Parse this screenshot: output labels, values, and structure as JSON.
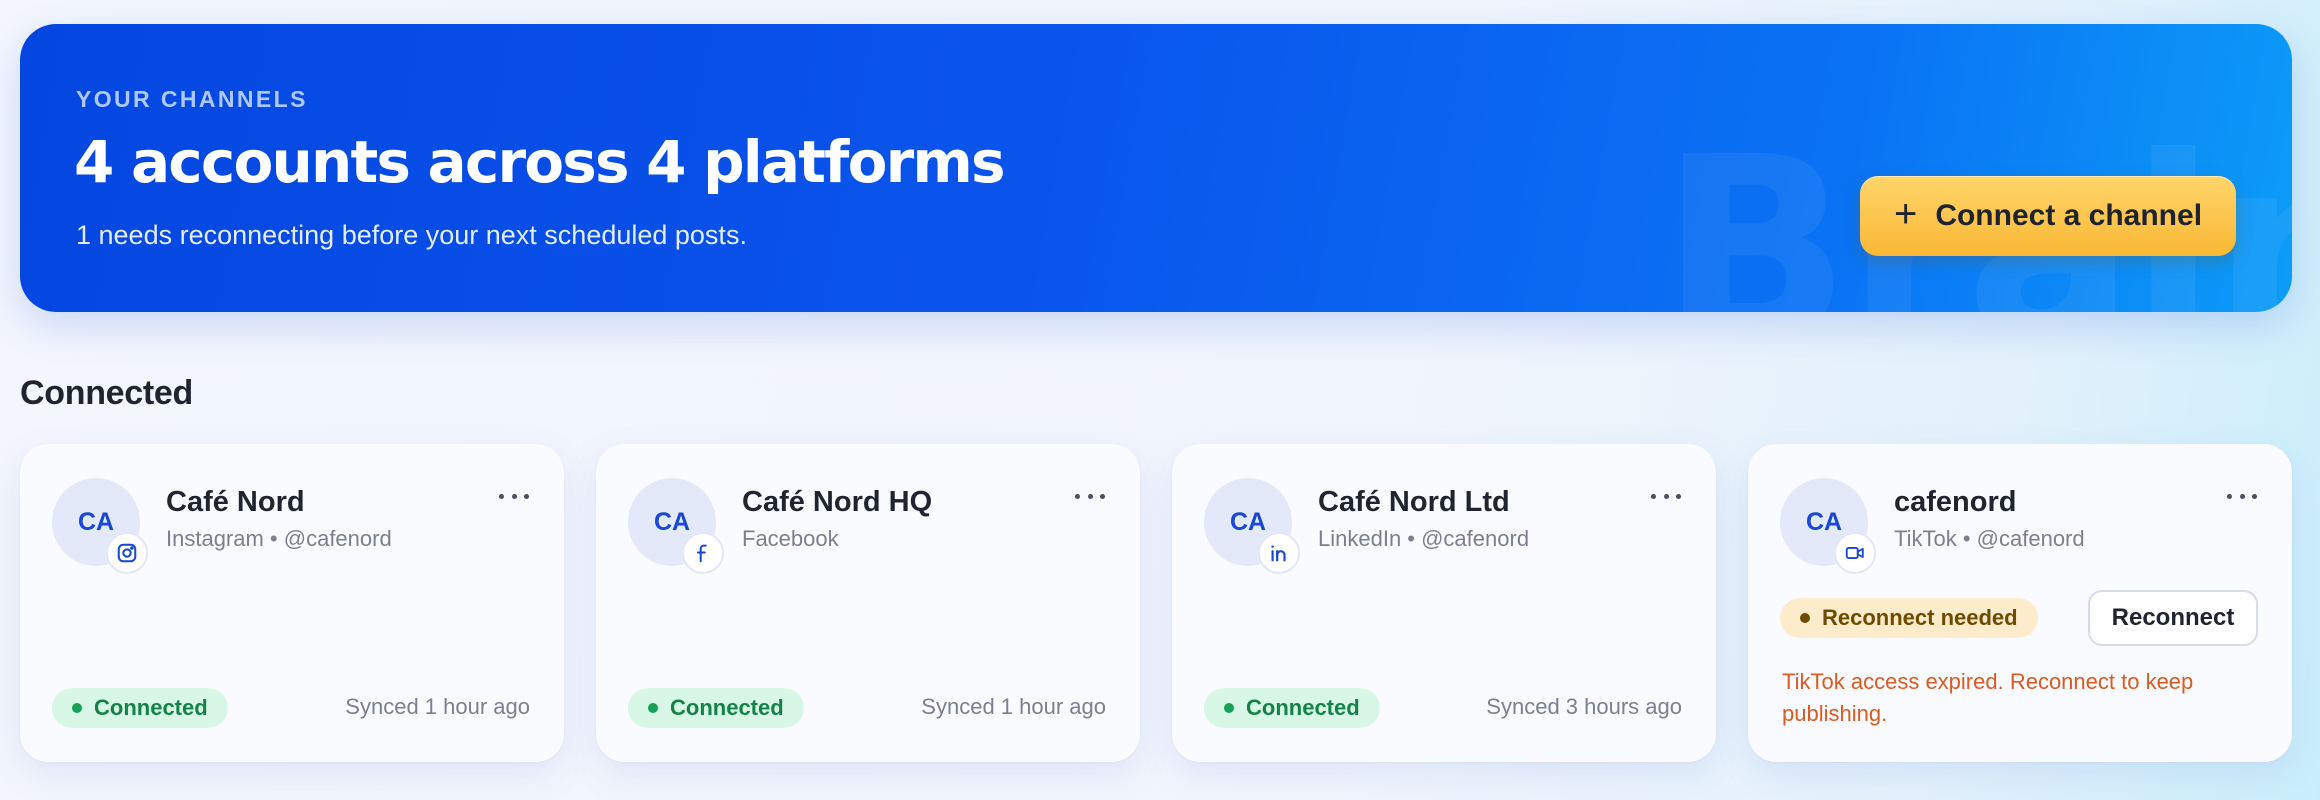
{
  "hero": {
    "eyebrow": "YOUR CHANNELS",
    "title": "4 accounts across 4 platforms",
    "subtitle": "1 needs reconnecting before your next scheduled posts.",
    "connect_button_icon": "plus-icon",
    "connect_button_label": "Connect a channel",
    "colors": {
      "gradient_start": "#0446e0",
      "gradient_end": "#0c9cf8",
      "button": "#f9b835"
    }
  },
  "section": {
    "title": "Connected"
  },
  "cards": [
    {
      "initials": "CA",
      "name": "Café Nord",
      "meta": "Instagram • @cafenord",
      "platform_icon": "instagram-icon",
      "status": "Connected",
      "synced": "Synced 1 hour ago"
    },
    {
      "initials": "CA",
      "name": "Café Nord HQ",
      "meta": "Facebook",
      "platform_icon": "facebook-icon",
      "status": "Connected",
      "synced": "Synced 1 hour ago"
    },
    {
      "initials": "CA",
      "name": "Café Nord Ltd",
      "meta": "LinkedIn • @cafenord",
      "platform_icon": "linkedin-icon",
      "status": "Connected",
      "synced": "Synced 3 hours ago"
    },
    {
      "initials": "CA",
      "name": "cafenord",
      "meta": "TikTok • @cafenord",
      "platform_icon": "video-icon",
      "status": "Reconnect needed",
      "action_label": "Reconnect",
      "error": "TikTok access expired. Reconnect to keep publishing."
    }
  ],
  "status_colors": {
    "connected": "#17a058",
    "warning": "#6f4a00",
    "error": "#dc5a24"
  }
}
